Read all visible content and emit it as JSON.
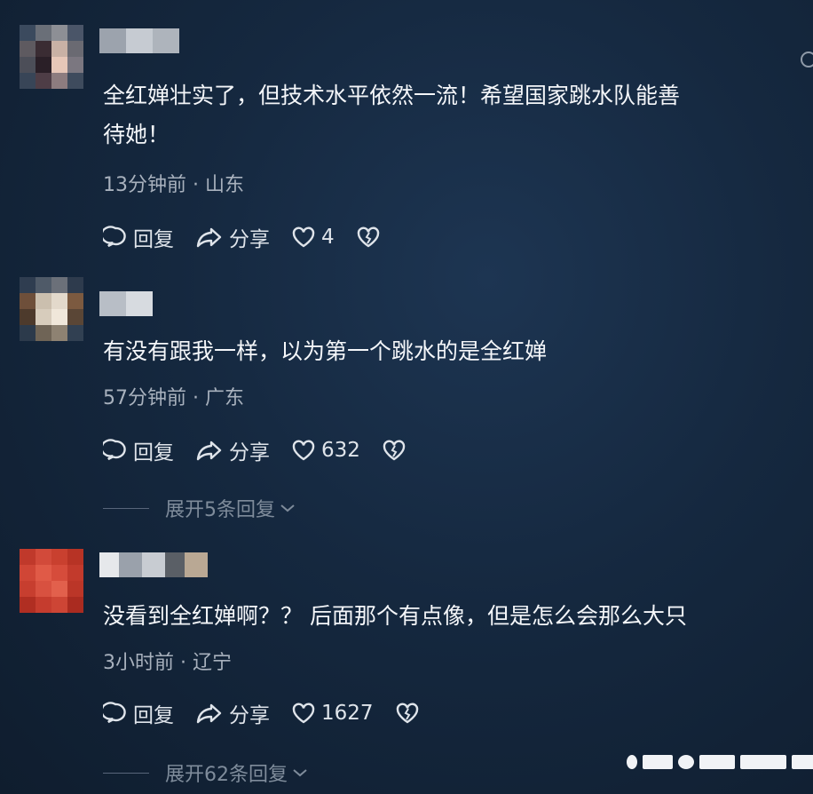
{
  "comments": [
    {
      "text_line1": "全红婵壮实了，但技术水平依然一流！希望国家跳水队能善",
      "text_line2": "待她！",
      "time": "13分钟前",
      "location": "山东",
      "reply_label": "回复",
      "share_label": "分享",
      "likes": "4"
    },
    {
      "text_line1": "有没有跟我一样，以为第一个跳水的是全红婵",
      "time": "57分钟前",
      "location": "广东",
      "reply_label": "回复",
      "share_label": "分享",
      "likes": "632",
      "expand_label": "展开5条回复"
    },
    {
      "text_line1": "没看到全红婵啊？？ 后面那个有点像，但是怎么会那么大只",
      "time": "3小时前",
      "location": "辽宁",
      "reply_label": "回复",
      "share_label": "分享",
      "likes": "1627",
      "expand_label": "展开62条回复"
    }
  ],
  "meta_separator": "·"
}
